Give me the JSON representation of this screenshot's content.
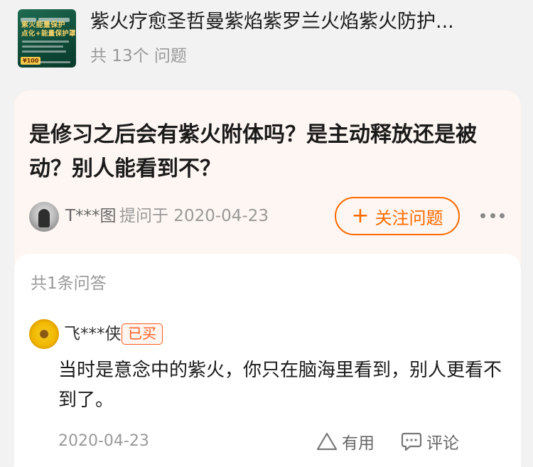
{
  "header": {
    "thumbnail": {
      "line1": "紫火能量保护",
      "line2": "点化+能量保护罩",
      "price": "¥100"
    },
    "title": "紫火疗愈圣哲曼紫焰紫罗兰火焰紫火防护...",
    "question_count": "共 13个 问题"
  },
  "question": {
    "title": "是修习之后会有紫火附体吗？是主动释放还是被动？别人能看到不？",
    "asker": "T***图",
    "date": "提问于 2020-04-23",
    "follow_label": "关注问题",
    "follow_icon": "plus-icon",
    "more_icon": "more-dots-icon"
  },
  "answers": {
    "count_label": "共1条问答",
    "items": [
      {
        "author": "飞***侠",
        "badge": "已买",
        "text": "当时是意念中的紫火，你只在脑海里看到，别人更看不到了。",
        "date": "2020-04-23",
        "useful_label": "有用",
        "useful_icon": "triangle-up-icon",
        "comment_label": "评论",
        "comment_icon": "comment-bubble-icon"
      }
    ]
  },
  "colors": {
    "accent": "#ff6a00",
    "badge": "#ff5a1f",
    "question_card_bg": "#fdf6f2",
    "page_bg": "#f2f2f2"
  }
}
